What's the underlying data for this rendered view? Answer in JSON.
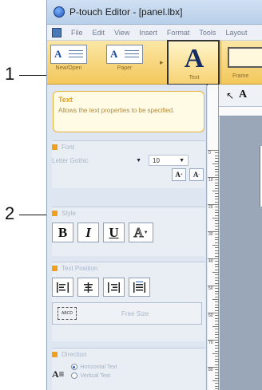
{
  "callouts": {
    "first": "1",
    "second": "2"
  },
  "window": {
    "title": "P-touch Editor - [panel.lbx]"
  },
  "menu": {
    "items": [
      "File",
      "Edit",
      "View",
      "Insert",
      "Format",
      "Tools",
      "Layout"
    ]
  },
  "ribbon": {
    "buttons": [
      {
        "label": "New/Open"
      },
      {
        "label": "Paper"
      },
      {
        "label": "Text"
      },
      {
        "label": "Frame"
      }
    ]
  },
  "toolbar": {
    "text_tool": "A"
  },
  "description": {
    "title": "Text",
    "text": "Allows the text properties to be specified."
  },
  "font": {
    "section": "Font",
    "name": "Letter Gothic",
    "size": "10",
    "grow_label": "A",
    "shrink_label": "A"
  },
  "style": {
    "section": "Style",
    "bold": "B",
    "italic": "I",
    "underline": "U",
    "outline": "A"
  },
  "text_position": {
    "section": "Text Position",
    "free_size_label": "Free Size",
    "free_size_icon_text": "ABCD"
  },
  "direction": {
    "section": "Direction",
    "icon": "A",
    "horizontal": "Horizontal Text",
    "vertical": "Vertical Text",
    "selected": "Horizontal Text"
  },
  "ruler": {
    "marks": [
      "0",
      "10",
      "20",
      "30",
      "40",
      "50",
      "60",
      "70",
      "80"
    ]
  },
  "colors": {
    "accent": "#f0a01c",
    "ribbon": "#f3c75b",
    "panel": "#dde6f1"
  }
}
